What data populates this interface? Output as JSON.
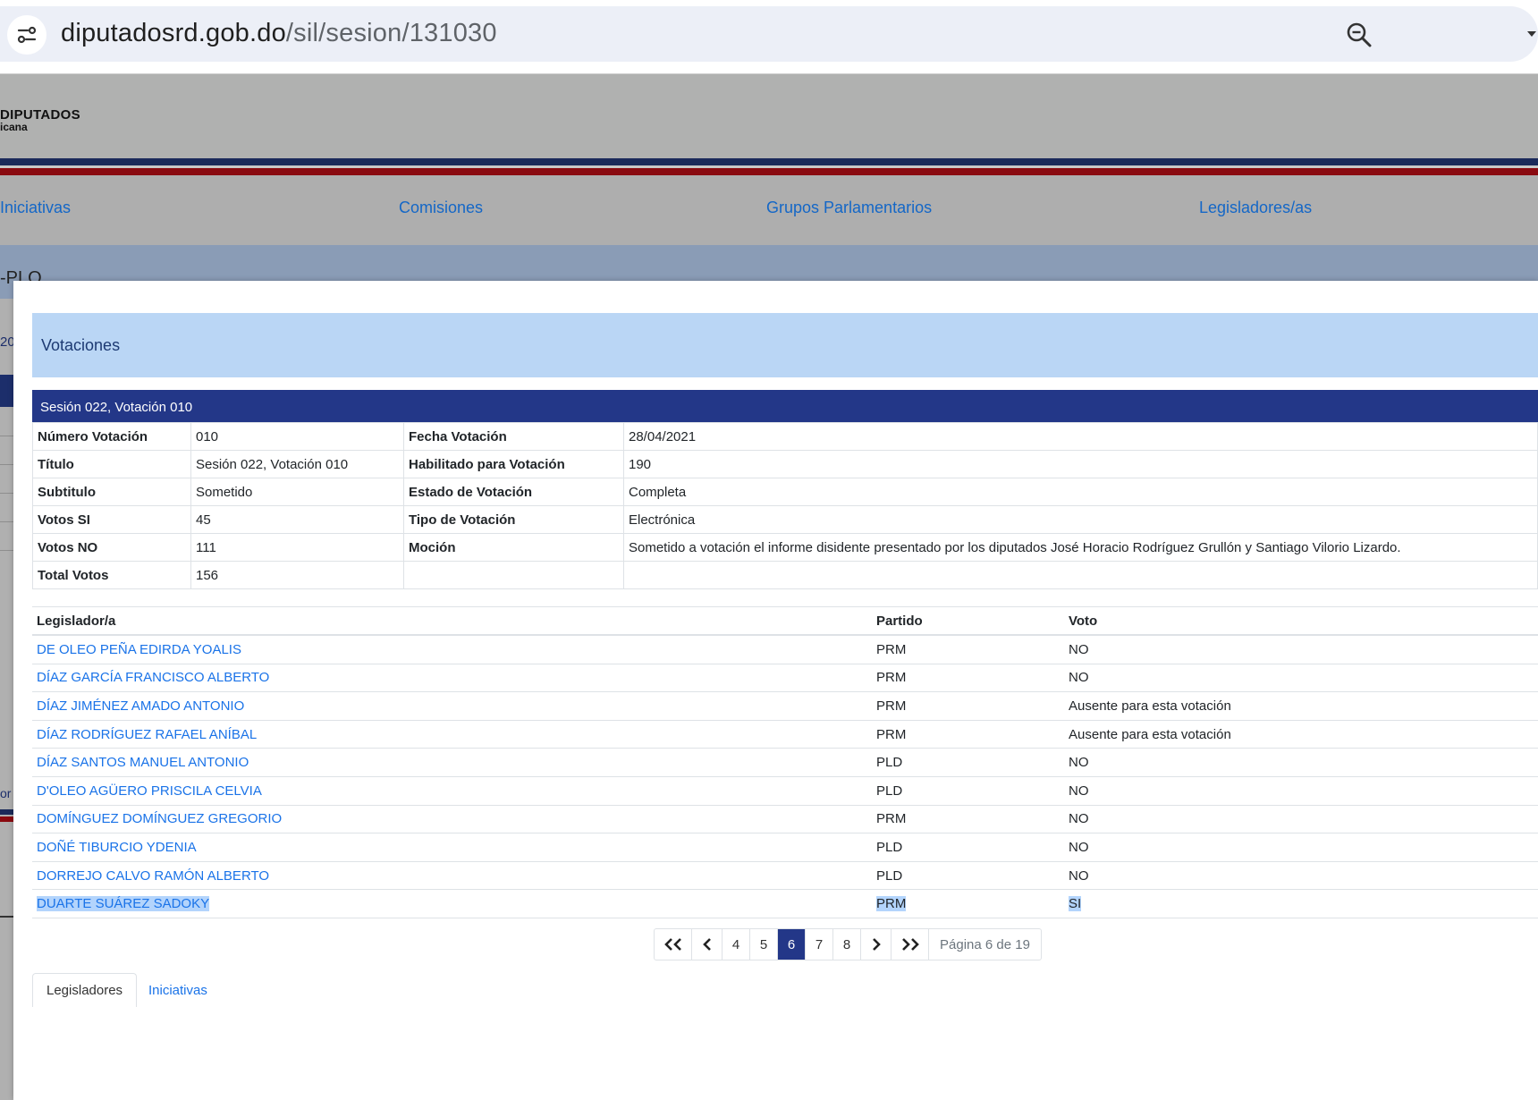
{
  "browser": {
    "url_host": "diputadosrd.gob.do",
    "url_path": "/sil/sesion/131030"
  },
  "background_page": {
    "logo_title": "DIPUTADOS",
    "logo_subtitle": "icana",
    "nav": [
      "Iniciativas",
      "Comisiones",
      "Grupos Parlamentarios",
      "Legisladores/as"
    ],
    "subbar_text": "-PLO",
    "side_fragment_1": "20",
    "side_fragment_2": "or"
  },
  "modal": {
    "header": "Votaciones",
    "session_bar": "Sesión 022, Votación 010",
    "info_rows": [
      {
        "l1": "Número Votación",
        "v1": "010",
        "l2": "Fecha Votación",
        "v2": "28/04/2021"
      },
      {
        "l1": "Título",
        "v1": "Sesión 022, Votación 010",
        "l2": "Habilitado para Votación",
        "v2": "190"
      },
      {
        "l1": "Subtitulo",
        "v1": "Sometido",
        "l2": "Estado de Votación",
        "v2": "Completa"
      },
      {
        "l1": "Votos SI",
        "v1": "45",
        "l2": "Tipo de Votación",
        "v2": "Electrónica"
      },
      {
        "l1": "Votos NO",
        "v1": "111",
        "l2": "Moción",
        "v2": "Sometido a votación el informe disidente presentado por los diputados José Horacio Rodríguez Grullón y Santiago Vilorio Lizardo."
      },
      {
        "l1": "Total Votos",
        "v1": "156",
        "l2": "",
        "v2": ""
      }
    ],
    "votes_table": {
      "headers": [
        "Legislador/a",
        "Partido",
        "Voto"
      ],
      "rows": [
        {
          "name": "DE OLEO PEÑA EDIRDA YOALIS",
          "party": "PRM",
          "vote": "NO"
        },
        {
          "name": "DÍAZ GARCÍA FRANCISCO ALBERTO",
          "party": "PRM",
          "vote": "NO"
        },
        {
          "name": "DÍAZ JIMÉNEZ AMADO ANTONIO",
          "party": "PRM",
          "vote": "Ausente para esta votación"
        },
        {
          "name": "DÍAZ RODRÍGUEZ RAFAEL ANÍBAL",
          "party": "PRM",
          "vote": "Ausente para esta votación"
        },
        {
          "name": "DÍAZ SANTOS MANUEL ANTONIO",
          "party": "PLD",
          "vote": "NO"
        },
        {
          "name": "D'OLEO AGÜERO PRISCILA CELVIA",
          "party": "PLD",
          "vote": "NO"
        },
        {
          "name": "DOMÍNGUEZ DOMÍNGUEZ GREGORIO",
          "party": "PRM",
          "vote": "NO"
        },
        {
          "name": "DOÑÉ TIBURCIO YDENIA",
          "party": "PLD",
          "vote": "NO"
        },
        {
          "name": "DORREJO CALVO RAMÓN ALBERTO",
          "party": "PLD",
          "vote": "NO"
        },
        {
          "name": "DUARTE SUÁREZ SADOKY",
          "party": "PRM",
          "vote": "SI"
        }
      ]
    },
    "pagination": {
      "pages": [
        "4",
        "5",
        "6",
        "7",
        "8"
      ],
      "current": "6",
      "info": "Página 6 de 19"
    },
    "tabs": [
      "Legisladores",
      "Iniciativas"
    ]
  }
}
